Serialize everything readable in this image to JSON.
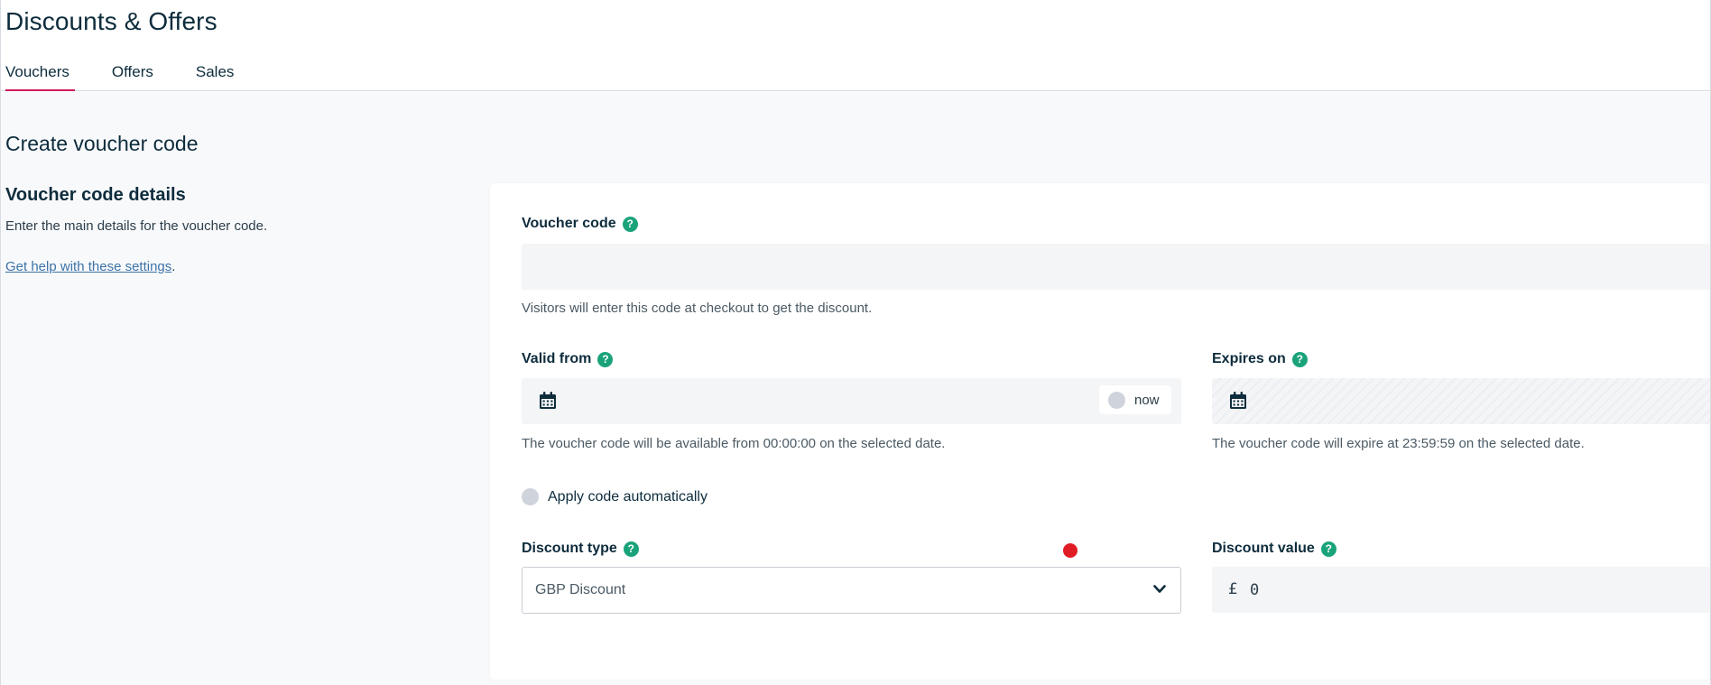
{
  "page": {
    "title": "Discounts & Offers",
    "tabs": [
      {
        "label": "Vouchers",
        "active": true
      },
      {
        "label": "Offers",
        "active": false
      },
      {
        "label": "Sales",
        "active": false
      }
    ]
  },
  "section": {
    "title": "Create voucher code",
    "details_title": "Voucher code details",
    "details_desc": "Enter the main details for the voucher code.",
    "help_link": "Get help with these settings",
    "help_link_suffix": "."
  },
  "form": {
    "voucher_code": {
      "label": "Voucher code",
      "help_icon": "?",
      "value": "",
      "hint": "Visitors will enter this code at checkout to get the discount."
    },
    "valid_from": {
      "label": "Valid from",
      "help_icon": "?",
      "now_label": "now",
      "hint": "The voucher code will be available from 00:00:00 on the selected date."
    },
    "expires_on": {
      "label": "Expires on",
      "help_icon": "?",
      "hint": "The voucher code will expire at 23:59:59 on the selected date."
    },
    "apply_auto": {
      "label": "Apply code automatically",
      "checked": false
    },
    "discount_type": {
      "label": "Discount type",
      "help_icon": "?",
      "selected": "GBP Discount"
    },
    "discount_value": {
      "label": "Discount value",
      "help_icon": "?",
      "currency_symbol": "£",
      "value": "0"
    }
  },
  "colors": {
    "accent_tab_underline": "#d1185b",
    "help_icon": "#1aa37a",
    "link": "#3c73a8",
    "marker": "#e01c24"
  }
}
